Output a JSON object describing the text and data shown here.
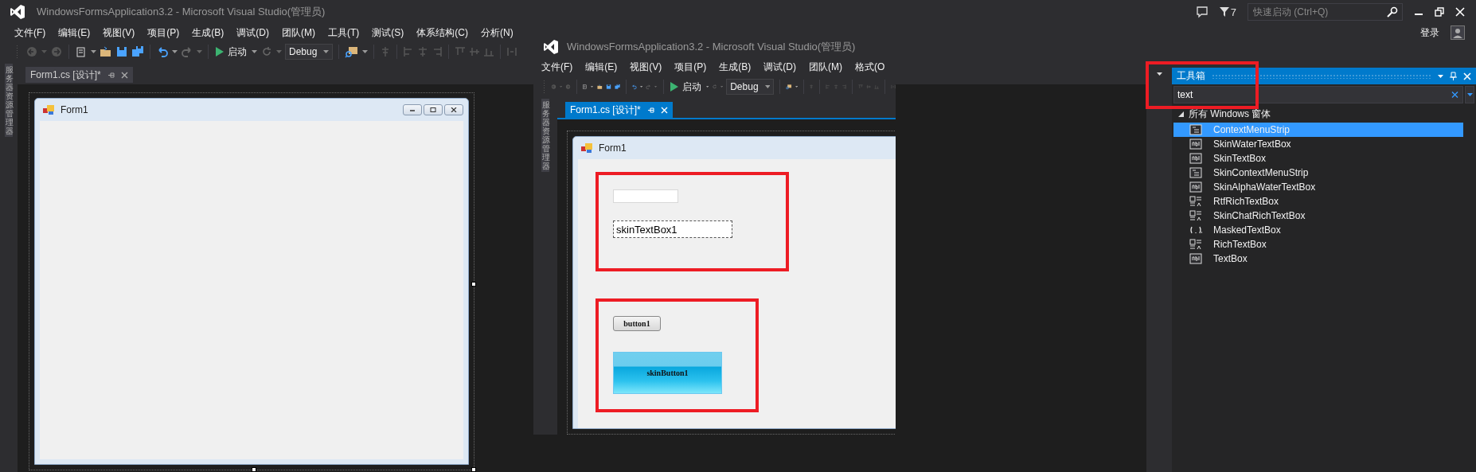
{
  "window": {
    "title": "WindowsFormsApplication3.2 - Microsoft Visual Studio(管理员)"
  },
  "title_bar": {
    "notification_count": "7",
    "quick_launch": {
      "placeholder": "快速启动 (Ctrl+Q)"
    }
  },
  "menu": [
    "文件(F)",
    "编辑(E)",
    "视图(V)",
    "项目(P)",
    "生成(B)",
    "调试(D)",
    "团队(M)",
    "工具(T)",
    "测试(S)",
    "体系结构(C)",
    "分析(N)"
  ],
  "account": {
    "sign_in": "登录"
  },
  "toolbar": {
    "start": "启动",
    "configuration": "Debug"
  },
  "side_strip": {
    "label": "服务器资源管理器"
  },
  "document_tabs": [
    {
      "label": "Form1.cs [设计]*",
      "selected": false
    }
  ],
  "designer": {
    "form": {
      "title": "Form1"
    }
  },
  "overlay_window": {
    "title": "WindowsFormsApplication3.2 - Microsoft Visual Studio(管理员)",
    "menu": [
      "文件(F)",
      "编辑(E)",
      "视图(V)",
      "项目(P)",
      "生成(B)",
      "调试(D)",
      "团队(M)",
      "格式(O"
    ],
    "toolbar": {
      "start": "启动",
      "configuration": "Debug"
    },
    "side_strip": {
      "label": "服务器资源管理器"
    },
    "document_tabs": [
      {
        "label": "Form1.cs [设计]*",
        "selected": true
      }
    ],
    "form": {
      "title": "Form1",
      "highlight_groups": [
        {
          "controls": [
            {
              "kind": "textbox",
              "focused": false
            },
            {
              "kind": "textbox",
              "value": "skinTextBox1",
              "focused": true
            }
          ]
        },
        {
          "controls": [
            {
              "kind": "button",
              "label": "button1"
            },
            {
              "kind": "skin_button",
              "label": "skinButton1"
            }
          ]
        }
      ]
    }
  },
  "toolbox": {
    "title": "工具箱",
    "highlighted": true,
    "search": {
      "value": "text"
    },
    "categories": [
      {
        "label": "所有 Windows 窗体",
        "expanded": true,
        "children": [
          {
            "label": "ContextMenuStrip",
            "kind": "menu",
            "selected": true
          },
          {
            "label": "SkinWaterTextBox",
            "kind": "textbox",
            "selected": false
          },
          {
            "label": "SkinTextBox",
            "kind": "textbox",
            "selected": false
          },
          {
            "label": "SkinContextMenuStrip",
            "kind": "menu",
            "selected": false
          },
          {
            "label": "SkinAlphaWaterTextBox",
            "kind": "textbox",
            "selected": false
          },
          {
            "label": "RtfRichTextBox",
            "kind": "rich",
            "selected": false
          },
          {
            "label": "SkinChatRichTextBox",
            "kind": "rich",
            "selected": false
          },
          {
            "label": "MaskedTextBox",
            "kind": "masked",
            "selected": false
          },
          {
            "label": "RichTextBox",
            "kind": "rich",
            "selected": false
          },
          {
            "label": "TextBox",
            "kind": "textbox",
            "selected": false
          }
        ]
      }
    ]
  }
}
